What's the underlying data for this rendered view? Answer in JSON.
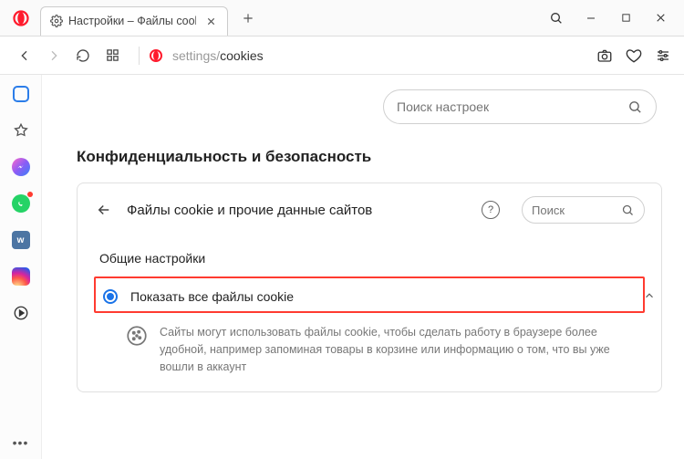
{
  "tab": {
    "title": "Настройки – Файлы cookie"
  },
  "address": {
    "prefix": "settings/",
    "path": "cookies"
  },
  "settings_search": {
    "placeholder": "Поиск настроек"
  },
  "section": {
    "title": "Конфиденциальность и безопасность"
  },
  "card": {
    "title": "Файлы cookie и прочие данные сайтов",
    "search_placeholder": "Поиск"
  },
  "subsection": {
    "title": "Общие настройки"
  },
  "option": {
    "label": "Показать все файлы cookie",
    "description": "Сайты могут использовать файлы cookie, чтобы сделать работу в браузере более удобной, например запоминая товары в корзине или информацию о том, что вы уже вошли в аккаунт"
  }
}
